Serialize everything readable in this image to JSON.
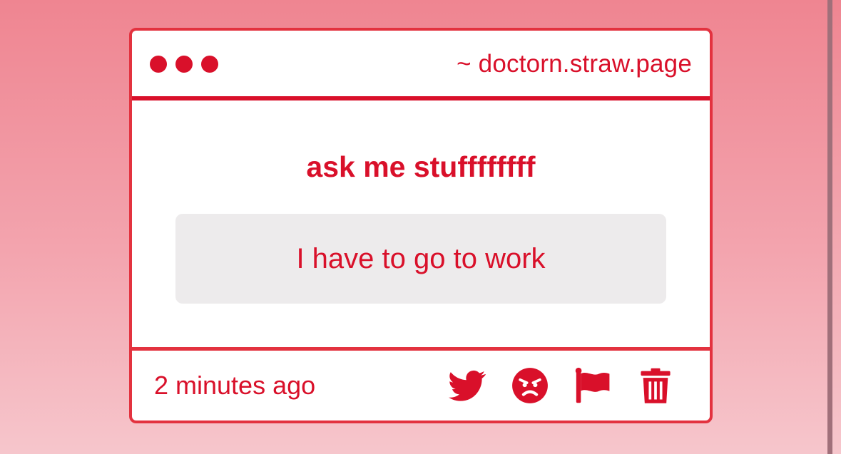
{
  "window": {
    "url": "~ doctorn.straw.page",
    "window_controls": [
      "dot",
      "dot",
      "dot"
    ]
  },
  "question": {
    "prompt": "ask me stuffffffff",
    "answer": "I have to go to work"
  },
  "footer": {
    "timestamp": "2 minutes ago",
    "actions": [
      "twitter-icon",
      "angry-face-icon",
      "flag-icon",
      "trash-icon"
    ]
  },
  "colors": {
    "accent": "#d9102a",
    "border": "#e3323f",
    "answer_background": "#edebec",
    "page_background_top": "#ef8591",
    "page_background_bottom": "#f6c6cc"
  }
}
